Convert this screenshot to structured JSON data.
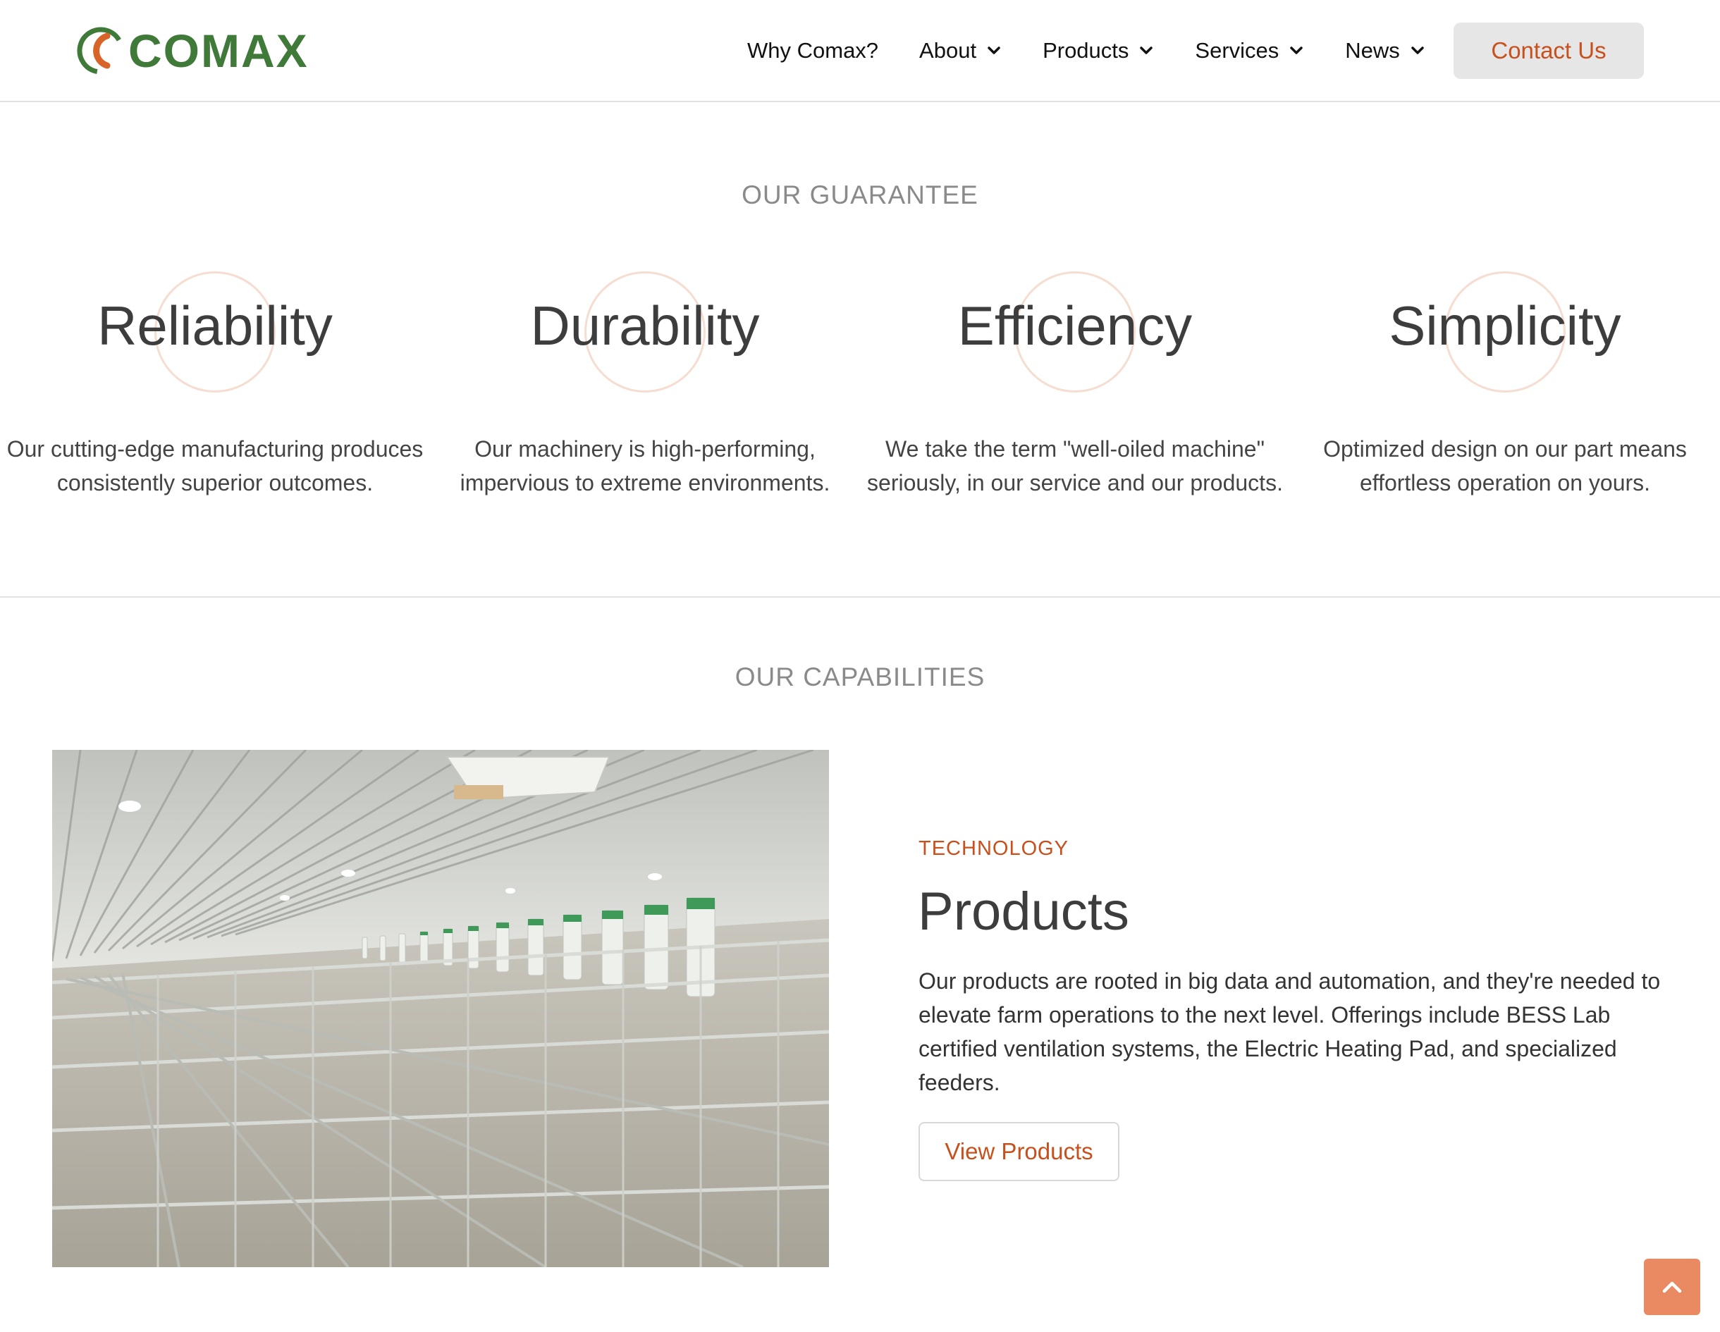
{
  "brand": {
    "name": "COMAX",
    "green": "#3f7a39",
    "orange": "#c8501d"
  },
  "nav": {
    "items": [
      {
        "label": "Why Comax?",
        "has_dropdown": false
      },
      {
        "label": "About",
        "has_dropdown": true
      },
      {
        "label": "Products",
        "has_dropdown": true
      },
      {
        "label": "Services",
        "has_dropdown": true
      },
      {
        "label": "News",
        "has_dropdown": true
      }
    ],
    "contact_label": "Contact Us"
  },
  "guarantee": {
    "heading": "OUR GUARANTEE",
    "items": [
      {
        "title": "Reliability",
        "desc_line1": "Our cutting-edge manufacturing produces",
        "desc_line2": "consistently superior outcomes."
      },
      {
        "title": "Durability",
        "desc_line1": "Our machinery is high-performing,",
        "desc_line2": "impervious to extreme environments."
      },
      {
        "title": "Efficiency",
        "desc_line1": "We take the term \"well-oiled machine\"",
        "desc_line2": "seriously, in our service and our products."
      },
      {
        "title": "Simplicity",
        "desc_line1": "Optimized design on our part means",
        "desc_line2": "effortless operation on yours."
      }
    ]
  },
  "capabilities": {
    "heading": "OUR CAPABILITIES",
    "label": "TECHNOLOGY",
    "title": "Products",
    "body": "Our products are rooted in big data and automation, and they're needed to elevate farm operations to the next level. Offerings include BESS Lab certified ventilation systems, the Electric Heating Pad, and specialized feeders.",
    "button_label": "View Products",
    "image_icon": "barn-interior-photo"
  },
  "scroll_top_icon": "chevron-up-icon"
}
